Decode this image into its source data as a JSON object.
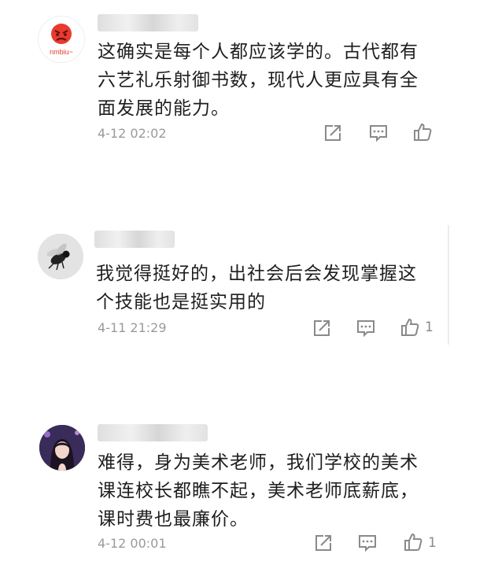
{
  "comments": [
    {
      "avatar_label": "nmbiu~",
      "username": "",
      "text": "这确实是每个人都应该学的。古代都有\n六艺礼乐射御书数，现代人更应具有全\n面发展的能力。",
      "time": "4-12 02:02",
      "likes": ""
    },
    {
      "avatar_label": "",
      "username": "",
      "text": "我觉得挺好的，出社会后会发现掌握这\n个技能也是挺实用的",
      "time": "4-11 21:29",
      "likes": "1"
    },
    {
      "avatar_label": "",
      "username": "",
      "text": "难得，身为美术老师，我们学校的美术\n课连校长都瞧不起，美术老师底薪底，\n课时费也最廉价。",
      "time": "4-12 00:01",
      "likes": "1"
    }
  ],
  "icons": {
    "share": "share-icon",
    "reply": "comment-icon",
    "like": "thumbs-up-icon"
  },
  "colors": {
    "text": "#1e1e1e",
    "meta": "#9a9a9a",
    "icon": "#8a8a8a"
  }
}
